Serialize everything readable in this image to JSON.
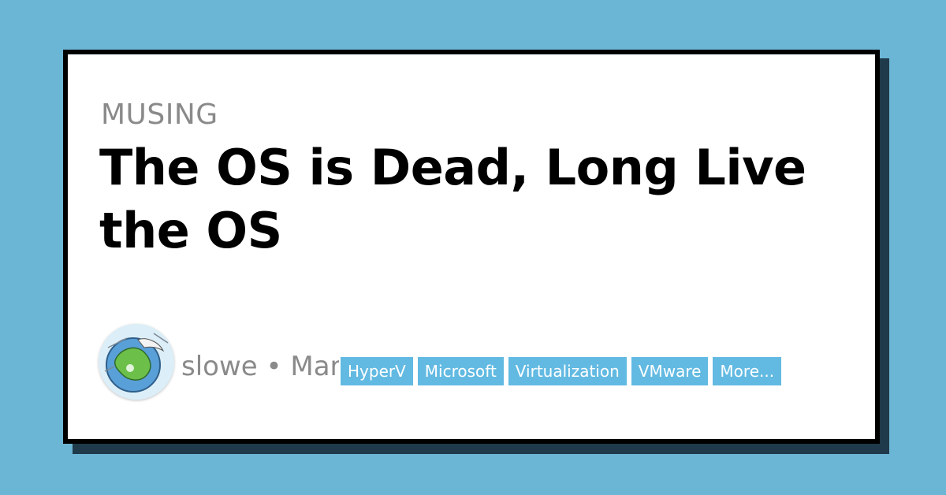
{
  "post": {
    "category": "MUSING",
    "title": "The OS is Dead, Long Live the OS",
    "byline": "slowe • Mar",
    "tags": [
      {
        "label": "HyperV"
      },
      {
        "label": "Microsoft"
      },
      {
        "label": "Virtualization"
      },
      {
        "label": "VMware"
      },
      {
        "label": "More..."
      }
    ]
  },
  "avatar": {
    "icon": "globe-avatar-icon"
  },
  "colors": {
    "background": "#6bb5d5",
    "card": "#ffffff",
    "card_border": "#000000",
    "card_shadow": "#1f3a4a",
    "tag_background": "#62bae2",
    "muted_text": "#8a8a8a"
  }
}
